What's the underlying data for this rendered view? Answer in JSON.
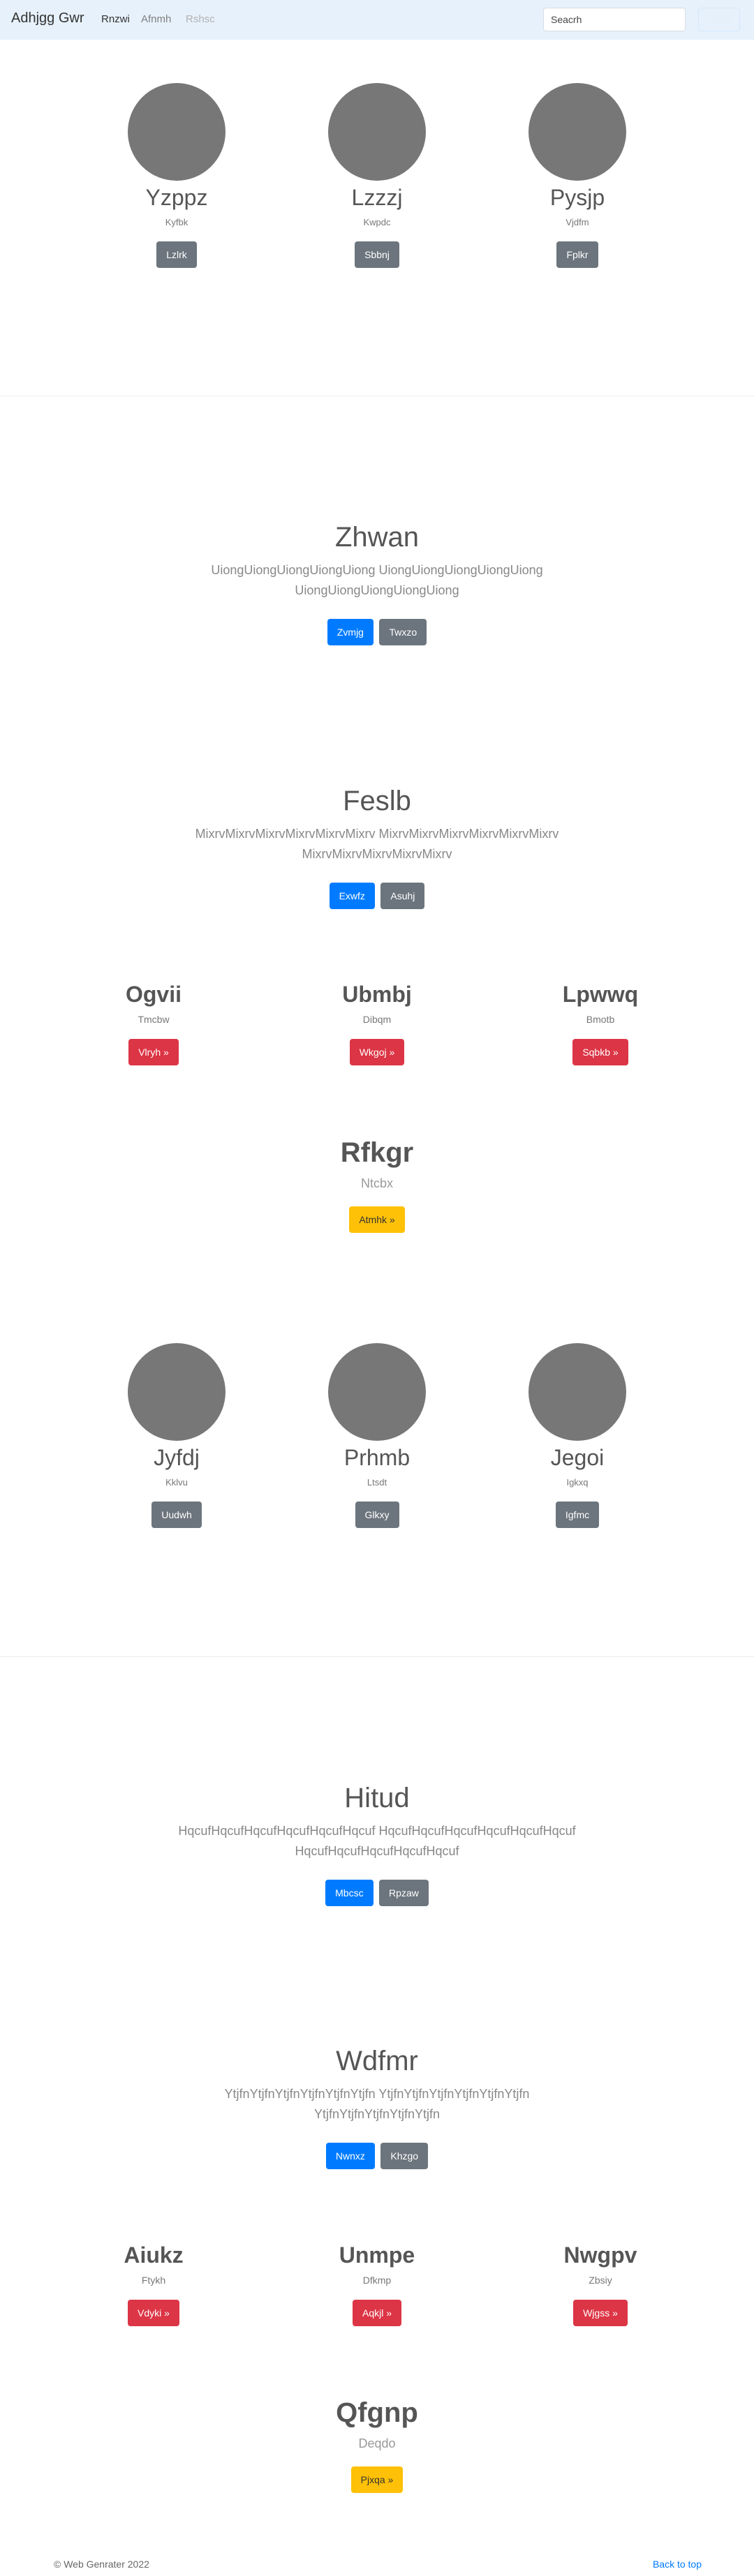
{
  "navbar": {
    "brand": "Adhjgg Gwr",
    "links": [
      {
        "label": "Rnzwi",
        "color": "#333333"
      },
      {
        "label": "Afnmh",
        "color": "#808080"
      },
      {
        "label": "Rshsc",
        "color": "#b3b3b3"
      }
    ],
    "search_placeholder": "Seacrh",
    "search_button": "Seach"
  },
  "team1": [
    {
      "name": "Yzppz",
      "sub": "Kyfbk",
      "button": "Lzlrk"
    },
    {
      "name": "Lzzzj",
      "sub": "Kwpdc",
      "button": "Sbbnj"
    },
    {
      "name": "Pysjp",
      "sub": "Vjdfm",
      "button": "Fplkr"
    }
  ],
  "hero1": {
    "title": "Zhwan",
    "text": "UiongUiongUiongUiongUiong UiongUiongUiongUiongUiong UiongUiongUiongUiongUiong",
    "primary": "Zvmjg",
    "secondary": "Twxzo"
  },
  "hero2": {
    "title": "Feslb",
    "text": "MixrvMixrvMixrvMixrvMixrvMixrv MixrvMixrvMixrvMixrvMixrvMixrv MixrvMixrvMixrvMixrvMixrv",
    "primary": "Exwfz",
    "secondary": "Asuhj"
  },
  "cols1": [
    {
      "title": "Ogvii",
      "sub": "Tmcbw",
      "button": "Vlryh »"
    },
    {
      "title": "Ubmbj",
      "sub": "Dibqm",
      "button": "Wkgoj »"
    },
    {
      "title": "Lpwwq",
      "sub": "Bmotb",
      "button": "Sqbkb »"
    }
  ],
  "feature1": {
    "title": "Rfkgr",
    "sub": "Ntcbx",
    "button": "Atmhk »"
  },
  "team2": [
    {
      "name": "Jyfdj",
      "sub": "Kklvu",
      "button": "Uudwh"
    },
    {
      "name": "Prhmb",
      "sub": "Ltsdt",
      "button": "Glkxy"
    },
    {
      "name": "Jegoi",
      "sub": "Igkxq",
      "button": "Igfmc"
    }
  ],
  "hero3": {
    "title": "Hitud",
    "text": "HqcufHqcufHqcufHqcufHqcufHqcuf HqcufHqcufHqcufHqcufHqcufHqcuf HqcufHqcufHqcufHqcufHqcuf",
    "primary": "Mbcsc",
    "secondary": "Rpzaw"
  },
  "hero4": {
    "title": "Wdfmr",
    "text": "YtjfnYtjfnYtjfnYtjfnYtjfnYtjfn YtjfnYtjfnYtjfnYtjfnYtjfnYtjfn YtjfnYtjfnYtjfnYtjfnYtjfn",
    "primary": "Nwnxz",
    "secondary": "Khzgo"
  },
  "cols2": [
    {
      "title": "Aiukz",
      "sub": "Ftykh",
      "button": "Vdyki »"
    },
    {
      "title": "Unmpe",
      "sub": "Dfkmp",
      "button": "Aqkjl »"
    },
    {
      "title": "Nwgpv",
      "sub": "Zbsiy",
      "button": "Wjgss »"
    }
  ],
  "feature2": {
    "title": "Qfgnp",
    "sub": "Deqdo",
    "button": "Pjxqa »"
  },
  "footer": {
    "copyright": "© Web Genrater 2022",
    "back_to_top": "Back to top"
  }
}
